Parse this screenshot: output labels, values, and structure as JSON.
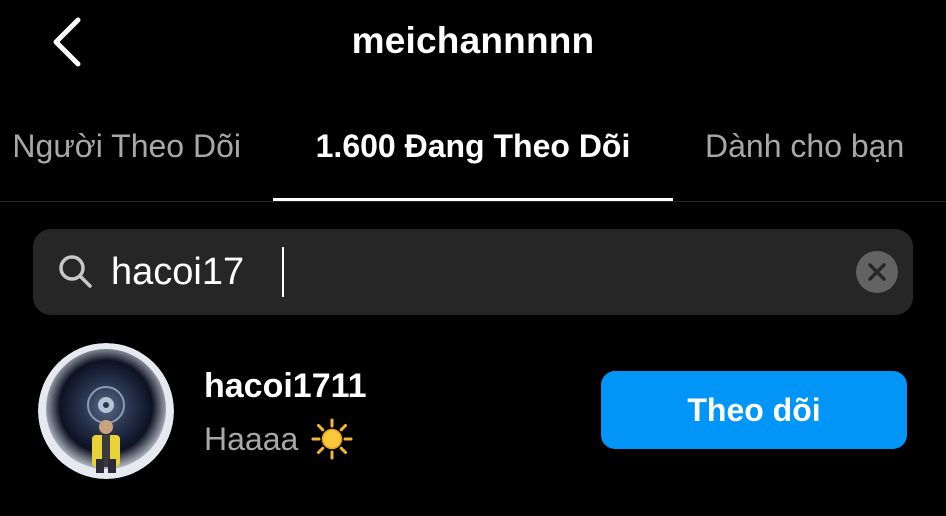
{
  "header": {
    "title": "meichannnnn",
    "back_icon": "chevron-left-icon"
  },
  "tabs": [
    {
      "label": "Người Theo Dõi",
      "active": false
    },
    {
      "label": "1.600 Đang Theo Dõi",
      "active": true
    },
    {
      "label": "Dành cho bạn",
      "active": false
    }
  ],
  "search": {
    "icon": "search-icon",
    "value": "hacoi17",
    "clear_icon": "clear-icon"
  },
  "results": [
    {
      "username": "hacoi1711",
      "full_name": "Haaaa",
      "name_emoji": "sun-icon",
      "follow_label": "Theo dõi"
    }
  ],
  "colors": {
    "background": "#000000",
    "search_bg": "#262626",
    "secondary_text": "#a8a8a8",
    "follow_button": "#0095f6"
  }
}
